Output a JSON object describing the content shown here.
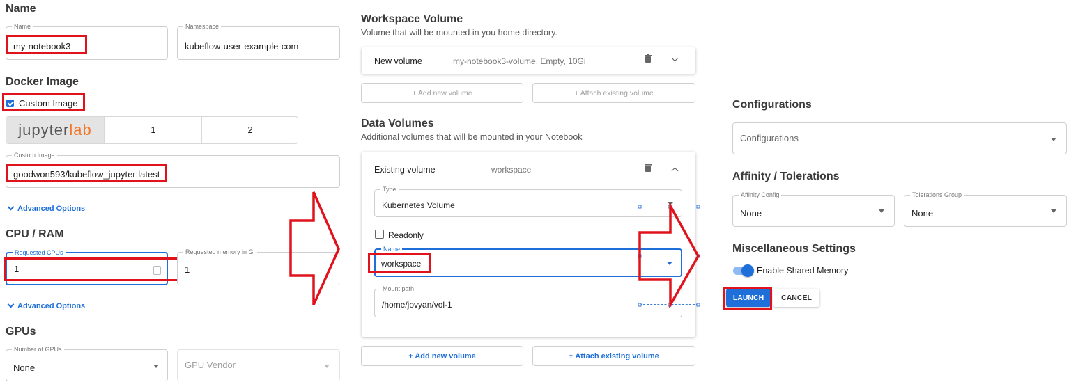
{
  "left": {
    "name_section": {
      "title": "Name",
      "name_label": "Name",
      "name_value": "my-notebook3",
      "namespace_label": "Namespace",
      "namespace_value": "kubeflow-user-example-com"
    },
    "docker": {
      "title": "Docker Image",
      "custom_image_label": "Custom Image",
      "custom_image_checked": true,
      "tabs": [
        {
          "jupyter": "jupyter",
          "lab": "lab"
        },
        {
          "label": "1"
        },
        {
          "label": "2"
        }
      ],
      "custom_field_label": "Custom Image",
      "custom_field_value": "goodwon593/kubeflow_jupyter:latest",
      "advanced": "Advanced Options"
    },
    "cpu": {
      "title": "CPU / RAM",
      "cpu_label": "Requested CPUs",
      "cpu_value": "1",
      "mem_label": "Requested memory in Gi",
      "mem_value": "1",
      "advanced": "Advanced Options"
    },
    "gpu": {
      "title": "GPUs",
      "num_label": "Number of GPUs",
      "num_value": "None",
      "vendor_placeholder": "GPU Vendor"
    }
  },
  "middle": {
    "workspace": {
      "title": "Workspace Volume",
      "subtitle": "Volume that will be mounted in you home directory.",
      "row_title": "New volume",
      "row_desc": "my-notebook3-volume, Empty, 10Gi",
      "add_new": "+ Add new volume",
      "attach_existing": "+ Attach existing volume"
    },
    "data": {
      "title": "Data Volumes",
      "subtitle": "Additional volumes that will be mounted in your Notebook",
      "row_title": "Existing volume",
      "row_desc": "workspace",
      "type_label": "Type",
      "type_value": "Kubernetes Volume",
      "readonly_label": "Readonly",
      "name_label": "Name",
      "name_value": "workspace",
      "mount_label": "Mount path",
      "mount_value": "/home/jovyan/vol-1",
      "add_new": "+ Add new volume",
      "attach_existing": "+ Attach existing volume"
    }
  },
  "right": {
    "configurations": {
      "title": "Configurations",
      "placeholder": "Configurations"
    },
    "affinity": {
      "title": "Affinity / Tolerations",
      "affinity_label": "Affinity Config",
      "affinity_value": "None",
      "tol_label": "Tolerations Group",
      "tol_value": "None"
    },
    "misc": {
      "title": "Miscellaneous Settings",
      "shared_memory_label": "Enable Shared Memory",
      "shared_memory_on": true
    },
    "launch": "LAUNCH",
    "cancel": "CANCEL"
  },
  "colors": {
    "accent": "#1e6fd9",
    "annotation": "#e0121b",
    "lab_orange": "#f37726"
  }
}
